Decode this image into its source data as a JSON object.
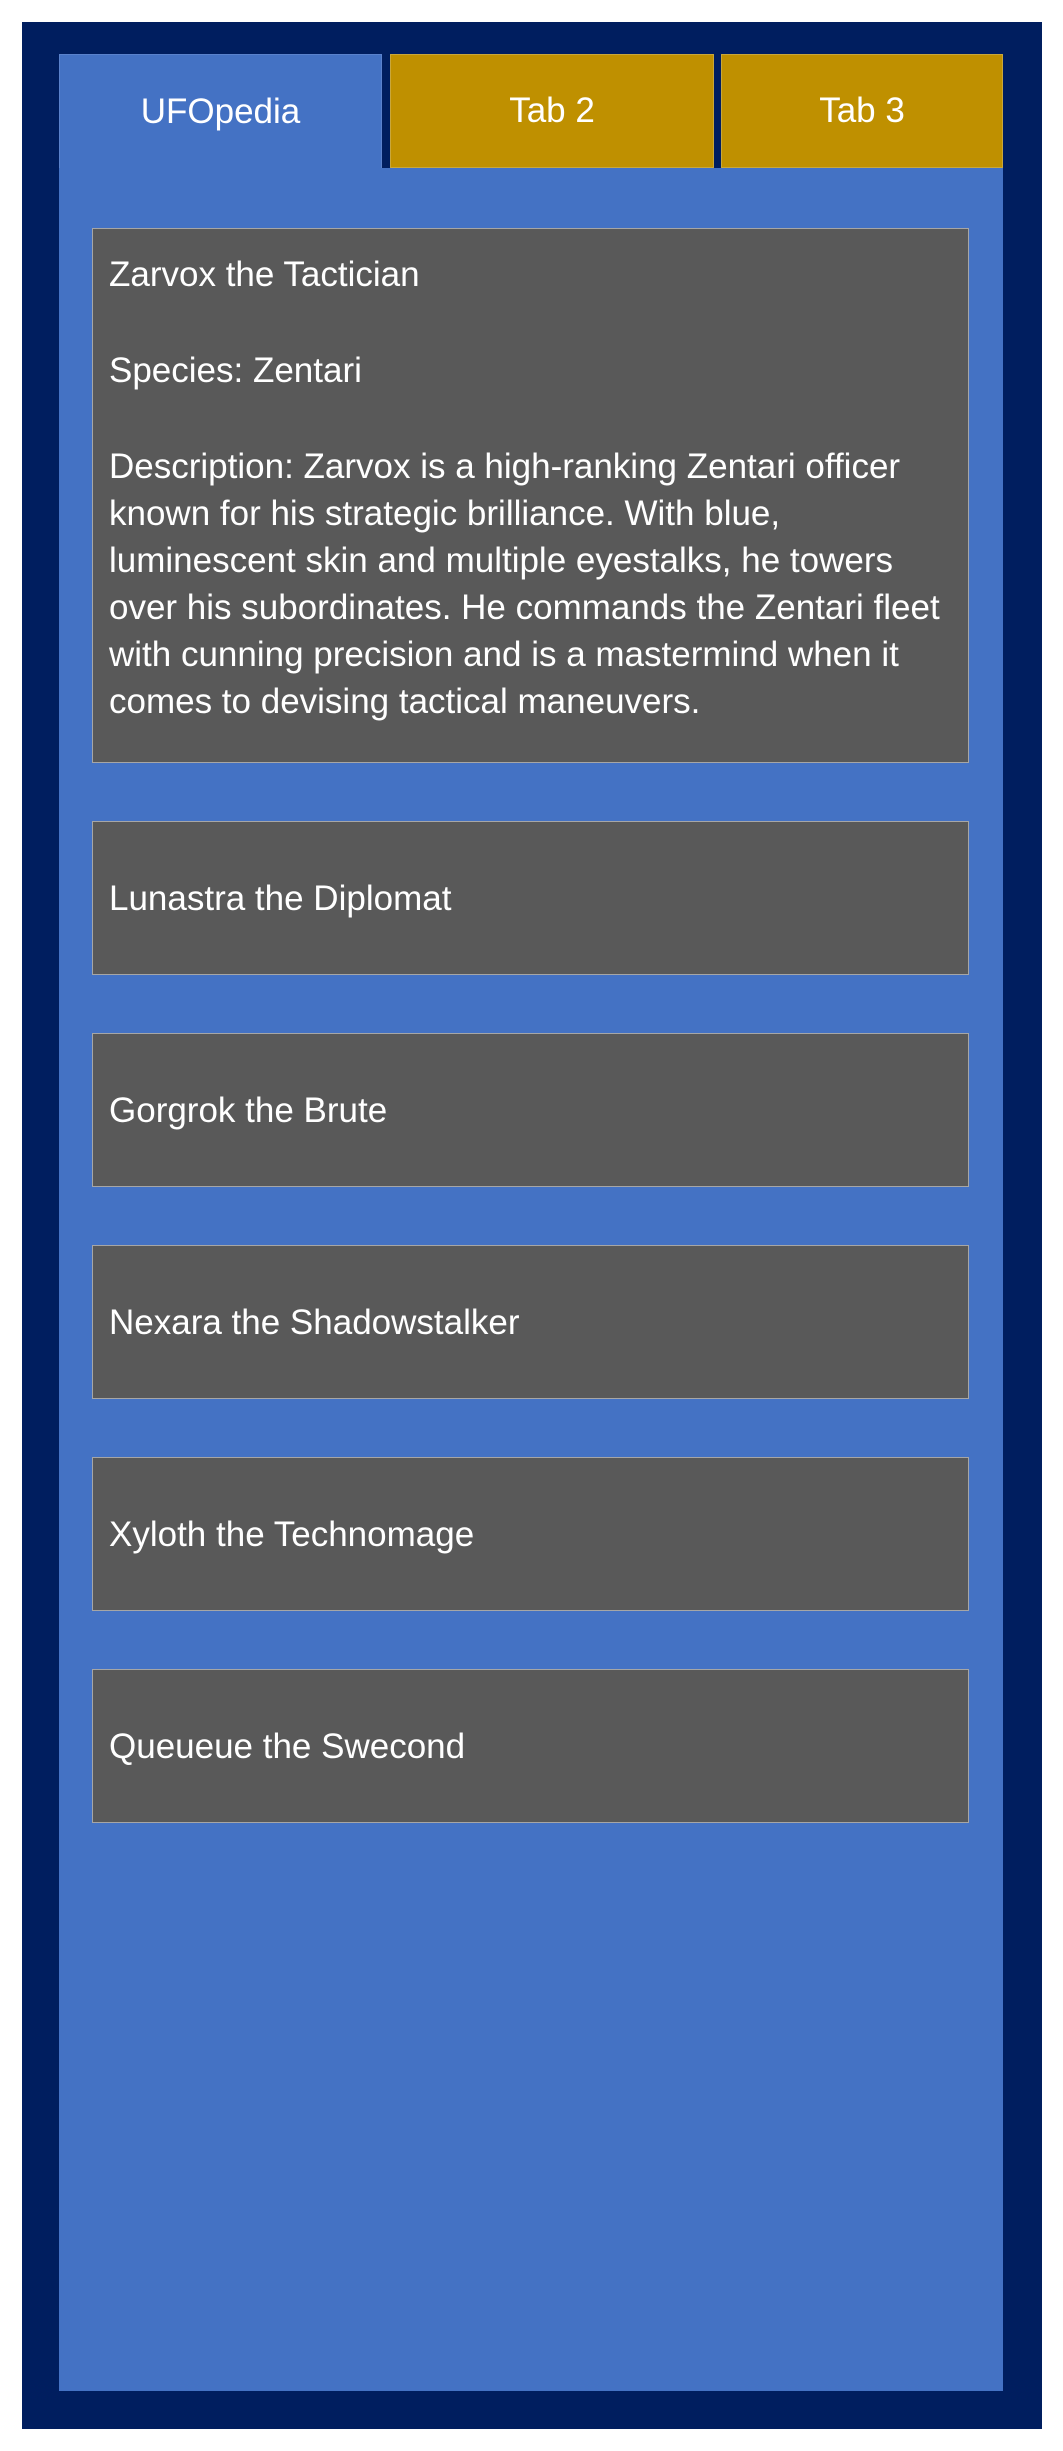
{
  "tabs": [
    {
      "label": "UFOpedia",
      "active": true
    },
    {
      "label": "Tab 2",
      "active": false
    },
    {
      "label": "Tab 3",
      "active": false
    }
  ],
  "entries": [
    {
      "name": "Zarvox the Tactician",
      "species": "Species: Zentari",
      "description": "Description: Zarvox is a high-ranking Zentari officer known for his strategic brilliance. With blue, luminescent skin and multiple eyestalks, he towers over his subordinates. He commands the Zentari fleet with cunning precision and is a mastermind when it comes to devising tactical maneuvers.",
      "expanded": true
    },
    {
      "name": "Lunastra the Diplomat",
      "expanded": false
    },
    {
      "name": "Gorgrok the Brute",
      "expanded": false
    },
    {
      "name": "Nexara the Shadowstalker",
      "expanded": false
    },
    {
      "name": "Xyloth the Technomage",
      "expanded": false
    },
    {
      "name": "Queueue the Swecond",
      "expanded": false
    }
  ],
  "colors": {
    "frame": "#001E5F",
    "panel": "#4472C4",
    "tab_active": "#4472C4",
    "tab_inactive": "#BF9000",
    "card": "#595959",
    "text": "#FFFFFF"
  }
}
